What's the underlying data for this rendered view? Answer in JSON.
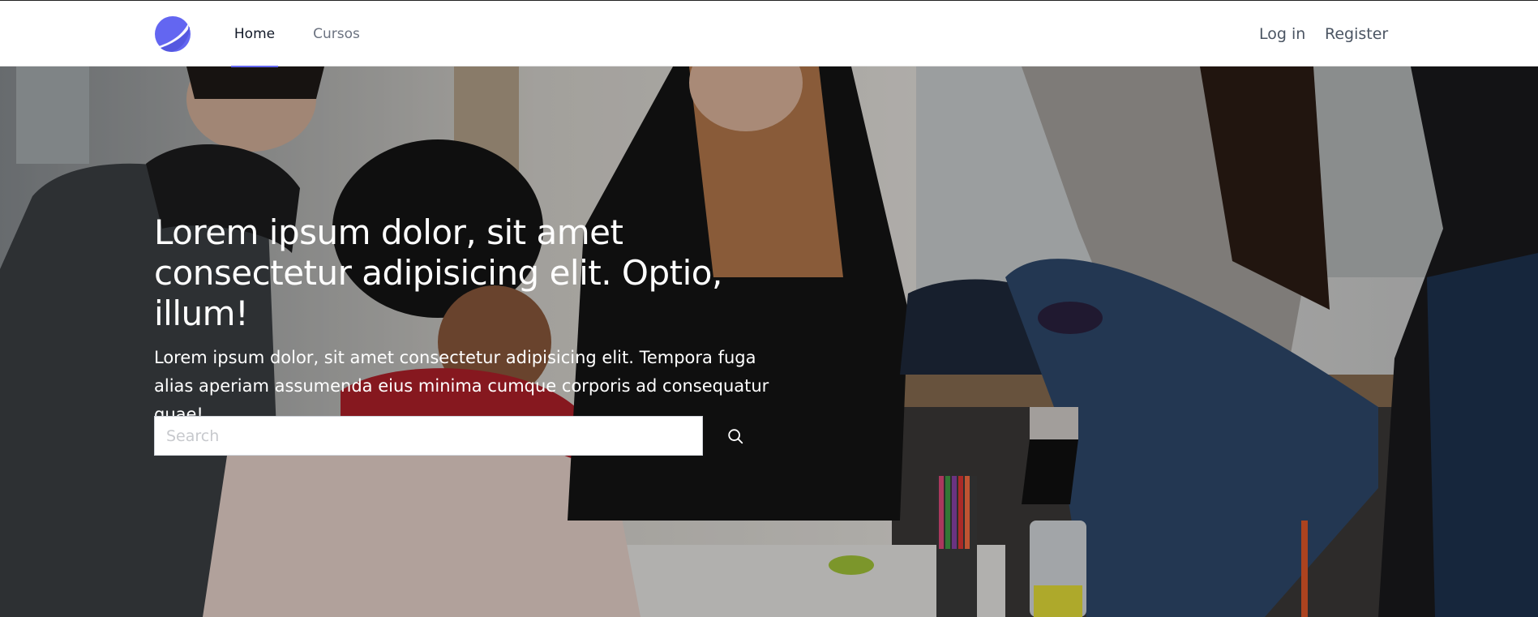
{
  "nav": {
    "logo_icon": "half-circle-logo-icon",
    "links": [
      {
        "label": "Home",
        "active": true
      },
      {
        "label": "Cursos",
        "active": false
      }
    ],
    "login_label": "Log in",
    "register_label": "Register",
    "accent_color": "#6366f1"
  },
  "hero": {
    "title": "Lorem ipsum dolor, sit amet consectetur adipisicing elit. Optio, illum!",
    "subtitle": "Lorem ipsum dolor, sit amet consectetur adipisicing elit. Tempora fuga alias aperiam assumenda eius minima cumque corporis ad consequatur quae!",
    "search_placeholder": "Search",
    "search_icon": "search-icon"
  }
}
